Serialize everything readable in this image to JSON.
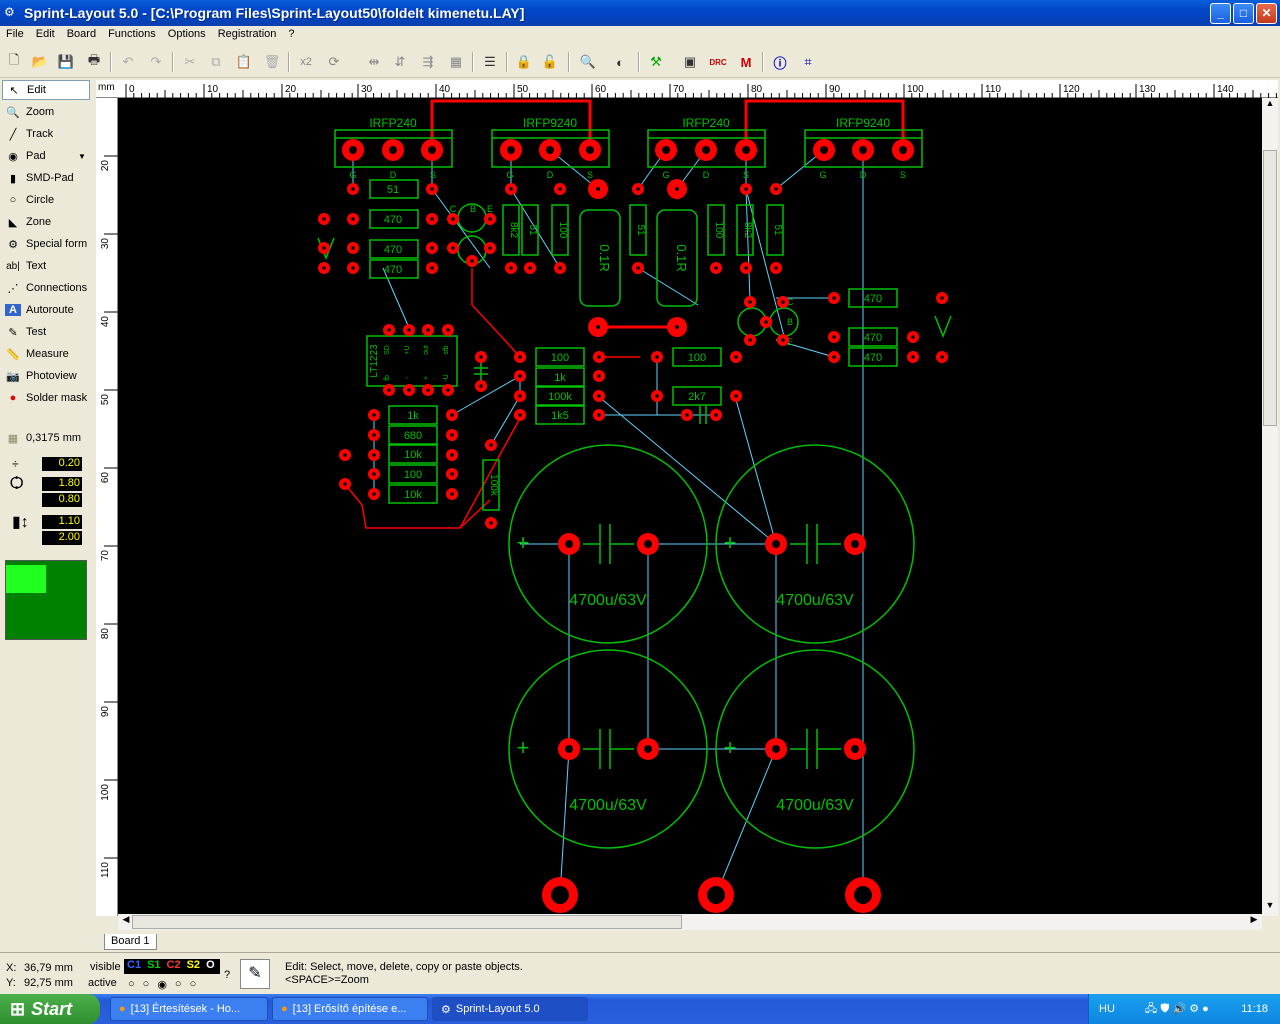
{
  "window": {
    "title": "Sprint-Layout 5.0 - [C:\\Program Files\\Sprint-Layout50\\foldelt kimenetu.LAY]",
    "minimize": "_",
    "maximize": "□",
    "close": "✕"
  },
  "menu": {
    "items": [
      "File",
      "Edit",
      "Board",
      "Functions",
      "Options",
      "Registration",
      "?"
    ]
  },
  "toolbar": {
    "multiply_label": "x2"
  },
  "tools": {
    "items": [
      "Edit",
      "Zoom",
      "Track",
      "Pad",
      "SMD-Pad",
      "Circle",
      "Zone",
      "Special form",
      "Text",
      "Connections",
      "Autoroute",
      "Test",
      "Measure",
      "Photoview",
      "Solder mask"
    ],
    "grid": "0,3175 mm",
    "track_width": "0.20",
    "pad_outer": "1.80",
    "pad_inner": "0.80",
    "smd_width": "1.10",
    "smd_height": "2.00"
  },
  "rulers": {
    "unit": "mm",
    "top_ticks": [
      "0",
      "10",
      "20",
      "30",
      "40",
      "50",
      "60",
      "70",
      "80",
      "90",
      "100",
      "110",
      "120",
      "130",
      "140"
    ],
    "left_ticks": [
      "20",
      "30",
      "40",
      "50",
      "60",
      "70",
      "80",
      "90",
      "100",
      "110"
    ]
  },
  "pcb": {
    "transistors": [
      {
        "name": "IRFP240",
        "pins": [
          "G",
          "D",
          "S"
        ]
      },
      {
        "name": "IRFP9240",
        "pins": [
          "G",
          "D",
          "S"
        ]
      },
      {
        "name": "IRFP240",
        "pins": [
          "G",
          "D",
          "S"
        ]
      },
      {
        "name": "IRFP9240",
        "pins": [
          "G",
          "D",
          "S"
        ]
      }
    ],
    "resistors_horizontal": [
      "51",
      "470",
      "470",
      "470",
      "100",
      "1k",
      "100k",
      "1k5",
      "100",
      "2k7",
      "1k",
      "680",
      "10k",
      "100",
      "10k",
      "470",
      "470",
      "470"
    ],
    "resistors_vertical": [
      "8k2",
      "51",
      "100",
      "51",
      "100",
      "8k2",
      "51",
      "100k"
    ],
    "shunts": [
      "0.1R",
      "0.1R"
    ],
    "ic_label": "LT1223",
    "ic_pins": [
      "SD",
      "+U",
      "out",
      "sfb",
      "fb",
      "-",
      "+",
      "-U"
    ],
    "capacitor_label": "4700u/63V",
    "cap_plus": "+",
    "bjt_pins": [
      "C",
      "B",
      "E"
    ]
  },
  "board_tab": "Board 1",
  "status": {
    "x_label": "X:",
    "x_value": "36,79 mm",
    "y_label": "Y:",
    "y_value": "92,75 mm",
    "visible_label": "visible",
    "active_label": "active",
    "layers": [
      "C1",
      "S1",
      "C2",
      "S2",
      "O"
    ],
    "help_mark": "?",
    "hint1": "Edit: Select, move, delete, copy or paste objects.",
    "hint2": "<SPACE>=Zoom"
  },
  "taskbar": {
    "start": "Start",
    "tasks": [
      "[13] Értesítések - Ho...",
      "[13] Erősítő építése e...",
      "Sprint-Layout 5.0"
    ],
    "lang": "HU",
    "clock": "11:18"
  },
  "colors": {
    "copper": "#ff0000",
    "silk": "#00c000",
    "rats": "#5fd3ff",
    "canvas": "#000000"
  }
}
